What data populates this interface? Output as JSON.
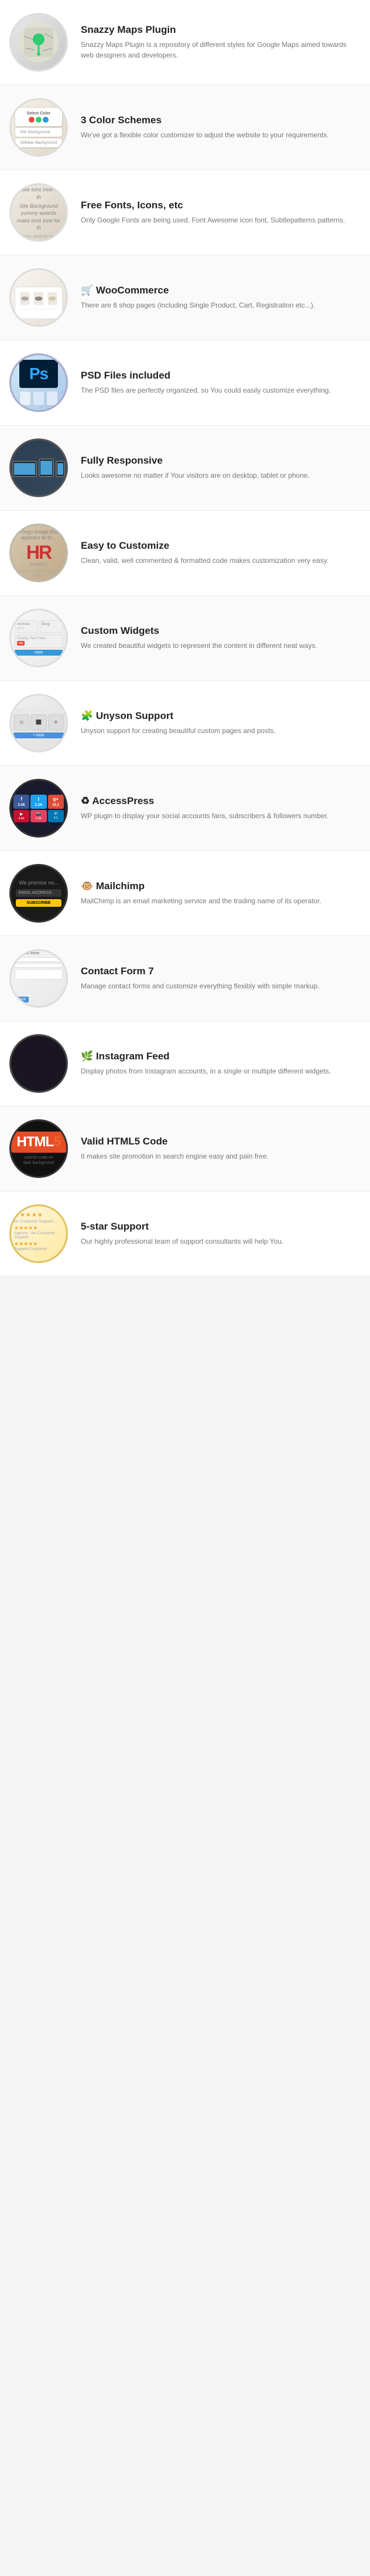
{
  "features": [
    {
      "id": "snazzy-maps",
      "title": "Snazzy Maps Plugin",
      "desc": "Snazzy Maps Plugin is a repository of different styles for Google Maps aimed towards web designers and developers.",
      "thumb_type": "snazzy",
      "icon": "📍"
    },
    {
      "id": "color-schemes",
      "title": "3 Color Schemes",
      "desc": "We've got a flexible color customizer to adjust the website to your requirements.",
      "thumb_type": "colors",
      "icon": "🎨"
    },
    {
      "id": "free-fonts",
      "title": "Free Fonts, Icons, etc",
      "desc": "Only Google Fonts are being used, Font Awesome icon font, Subtlepatterns patterns.",
      "thumb_type": "fonts",
      "icon": "Aa"
    },
    {
      "id": "woocommerce",
      "title": "🛒 WooCommerce",
      "desc": "There are 6 shop pages (including Single Product, Cart, Registration etc...).",
      "thumb_type": "woo",
      "icon": "🛒"
    },
    {
      "id": "psd-files",
      "title": "PSD Files included",
      "desc": "The PSD files are perfectly organized, so You could easily customize everything.",
      "thumb_type": "psd",
      "icon": "Ps"
    },
    {
      "id": "responsive",
      "title": "Fully Responsive",
      "desc": "Looks awesome no matter if Your visitors are on desktop, tablet or phone.",
      "thumb_type": "responsive",
      "icon": "📱"
    },
    {
      "id": "customize",
      "title": "Easy to Customize",
      "desc": "Clean, valid, well commented & formatted code makes customization very easy.",
      "thumb_type": "customize",
      "icon": "HR"
    },
    {
      "id": "widgets",
      "title": "Custom Widgets",
      "desc": "We created beautiful widgets to represent the content in different neat ways.",
      "thumb_type": "widgets",
      "icon": "⊞"
    },
    {
      "id": "unyson",
      "title": "🧩 Unyson Support",
      "desc": "Unyson support for creating beautiful custom pages and posts.",
      "thumb_type": "unyson",
      "icon": "🧩"
    },
    {
      "id": "accesspress",
      "title": "♻ AccessPress",
      "desc": "WP plugin to display your social accounts fans, subscribers & followers number.",
      "thumb_type": "access",
      "icon": "AP"
    },
    {
      "id": "mailchimp",
      "title": "🐵 Mailchimp",
      "desc": "MailChimp is an email marketing service and the trading name of its operator.",
      "thumb_type": "mailchimp",
      "icon": "✉"
    },
    {
      "id": "contact-form",
      "title": "Contact Form 7",
      "desc": "Manage contact forms and customize everything flexibly with simple markup.",
      "thumb_type": "contact",
      "icon": "📋"
    },
    {
      "id": "instagram",
      "title": "🌿 Instagram Feed",
      "desc": "Display photos from Instagram accounts, in a single or multiple different widgets.",
      "thumb_type": "instagram",
      "icon": "📷"
    },
    {
      "id": "html5",
      "title": "Valid HTML5 Code",
      "desc": "It makes site promotion in search engine easy and pain free.",
      "thumb_type": "html5",
      "icon": "HTML5"
    },
    {
      "id": "support",
      "title": "5-star Support",
      "desc": "Our highly professional team of support consultants will help You.",
      "thumb_type": "support",
      "icon": "⭐"
    }
  ]
}
